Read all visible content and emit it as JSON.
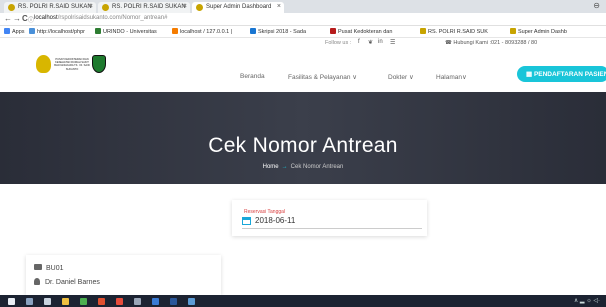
{
  "browser": {
    "tabs": [
      {
        "label": "RS. POLRI R.SAID SUKAN"
      },
      {
        "label": "RS. POLRI R.SAID SUKAN"
      },
      {
        "label": "Super Admin Dashboard"
      }
    ],
    "tab_close": "×",
    "window_control": "⊖",
    "nav": {
      "back": "←",
      "forward": "→",
      "reload": "C",
      "info": "ⓘ"
    },
    "url_host": "localhost",
    "url_path": "/rspolrisaidsukanto.com/Nomor_antrean#",
    "bookmarks": [
      {
        "label": "Apps",
        "color": "#4285f4"
      },
      {
        "label": "http://localhost/phpr",
        "color": "#4a90d9"
      },
      {
        "label": "URINDO - Universitas",
        "color": "#2e7d32"
      },
      {
        "label": "localhost / 127.0.0.1 |",
        "color": "#f57c00"
      },
      {
        "label": "Skripsi 2018 - Sada",
        "color": "#1976d2"
      },
      {
        "label": "Pusat Kedokteran dan",
        "color": "#b71c1c"
      },
      {
        "label": "RS. POLRI R.SAID SUK",
        "color": "#c8a400"
      },
      {
        "label": "Super Admin Dashb",
        "color": "#c8a400"
      }
    ]
  },
  "topinfo": {
    "follow": "Follow us :",
    "social": [
      "f",
      "❦",
      "in",
      "☰"
    ],
    "hotline": "☎ Hubungi Kami :021 - 8093288 / 80"
  },
  "logo": {
    "text": "PUSAT KEDOKTERAN DAN KESEHATAN RUMAH SAKIT BHAYANGKARA TK. I R. SAID SUKANTO"
  },
  "menu": [
    {
      "label": "Beranda"
    },
    {
      "label": "Fasilitas & Pelayanan ∨"
    },
    {
      "label": "Dokter ∨"
    },
    {
      "label": "Halaman∨"
    }
  ],
  "cta": {
    "label": "▦ PENDAFTARAN PASIEN"
  },
  "hero": {
    "title": "Cek Nomor Antrean",
    "crumb_home": "Home",
    "crumb_sep": "→",
    "crumb_current": "Cek Nomor Antrean"
  },
  "date_field": {
    "label": "Reservasi Tanggal",
    "value": "2018-06-11"
  },
  "doctor_card": {
    "code": "BU01",
    "name": "Dr. Daniel Barnes"
  },
  "taskbar": {
    "tray": "∧ ▂ ☼ ◁·"
  }
}
